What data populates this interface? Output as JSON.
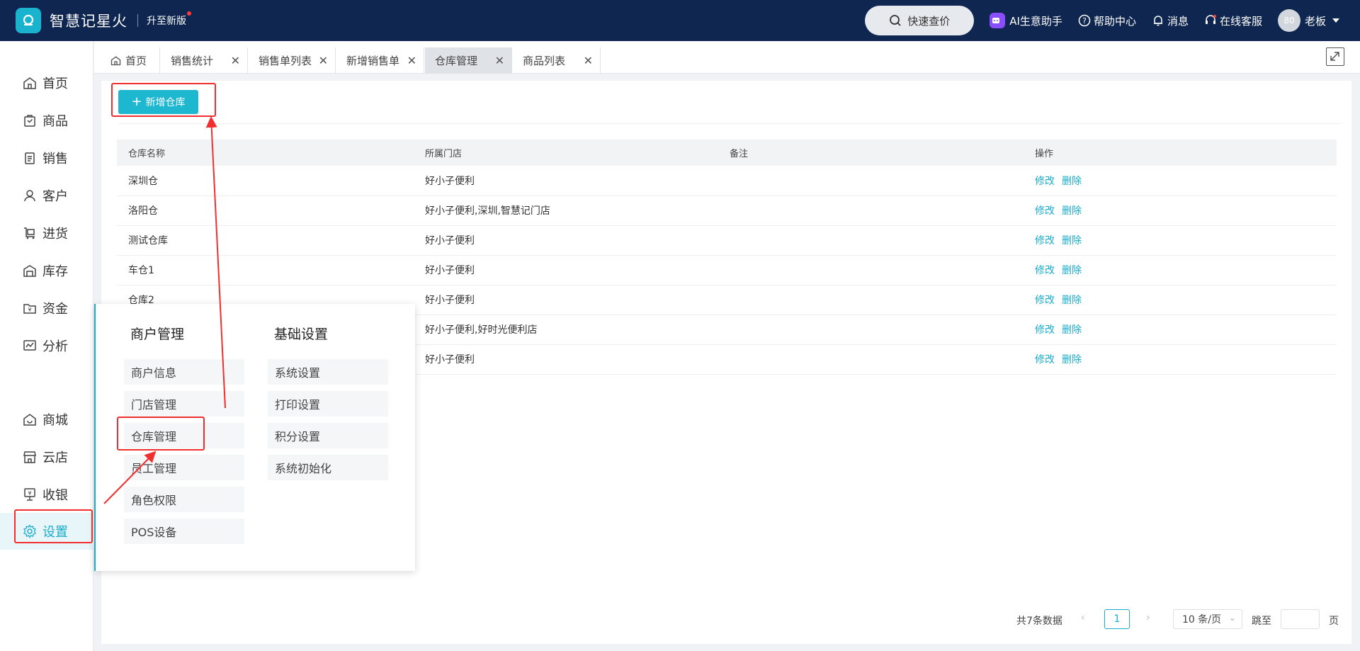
{
  "header": {
    "brand": "智慧记星火",
    "upgrade": "升至新版",
    "quick_price": "快速查价",
    "ai_assistant": "AI生意助手",
    "help": "帮助中心",
    "messages": "消息",
    "online_service": "在线客服",
    "avatar_text": "80",
    "user_name": "老板"
  },
  "sidebar": {
    "items": [
      {
        "label": "首页",
        "icon": "home-icon"
      },
      {
        "label": "商品",
        "icon": "bag-icon"
      },
      {
        "label": "销售",
        "icon": "clipboard-icon"
      },
      {
        "label": "客户",
        "icon": "user-icon"
      },
      {
        "label": "进货",
        "icon": "cart-icon"
      },
      {
        "label": "库存",
        "icon": "warehouse-icon"
      },
      {
        "label": "资金",
        "icon": "folder-yen-icon"
      },
      {
        "label": "分析",
        "icon": "chart-icon"
      },
      {
        "label": "商城",
        "icon": "mall-icon"
      },
      {
        "label": "云店",
        "icon": "store-icon"
      },
      {
        "label": "收银",
        "icon": "cashier-icon"
      },
      {
        "label": "设置",
        "icon": "gear-icon"
      }
    ]
  },
  "tabs": [
    {
      "label": "首页"
    },
    {
      "label": "销售统计"
    },
    {
      "label": "销售单列表"
    },
    {
      "label": "新增销售单"
    },
    {
      "label": "仓库管理"
    },
    {
      "label": "商品列表"
    }
  ],
  "toolbar": {
    "add_label": "新增仓库"
  },
  "table": {
    "columns": [
      "仓库名称",
      "所属门店",
      "备注",
      "操作"
    ],
    "rows": [
      {
        "name": "深圳仓",
        "store": "好小子便利",
        "note": ""
      },
      {
        "name": "洛阳仓",
        "store": "好小子便利,深圳,智慧记门店",
        "note": ""
      },
      {
        "name": "测试仓库",
        "store": "好小子便利",
        "note": ""
      },
      {
        "name": "车仓1",
        "store": "好小子便利",
        "note": ""
      },
      {
        "name": "仓库2",
        "store": "好小子便利",
        "note": ""
      },
      {
        "name": "",
        "store": "好小子便利,好时光便利店",
        "note": ""
      },
      {
        "name": "",
        "store": "好小子便利",
        "note": ""
      }
    ],
    "edit_label": "修改",
    "delete_label": "删除"
  },
  "pagination": {
    "total_text": "共7条数据",
    "current_page": "1",
    "page_size": "10 条/页",
    "jump_label": "跳至",
    "page_label": "页"
  },
  "flyout": {
    "merchant_title": "商户管理",
    "merchant_items": [
      "商户信息",
      "门店管理",
      "仓库管理",
      "员工管理",
      "角色权限",
      "POS设备"
    ],
    "basic_title": "基础设置",
    "basic_items": [
      "系统设置",
      "打印设置",
      "积分设置",
      "系统初始化"
    ]
  },
  "colors": {
    "topbar": "#0f2650",
    "accent": "#1aaccb",
    "annotation": "#f22f2f"
  }
}
